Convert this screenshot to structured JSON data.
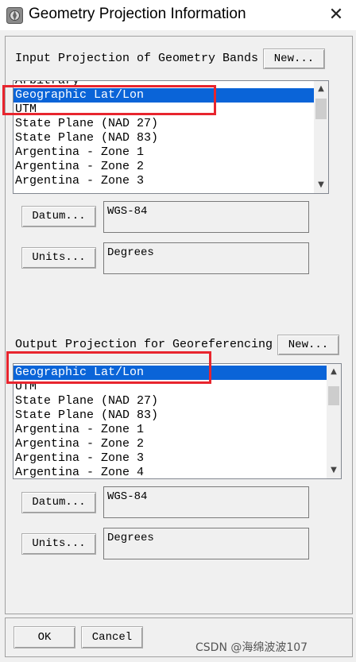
{
  "window": {
    "title": "Geometry Projection Information",
    "close_symbol": "✕"
  },
  "input_section": {
    "label": "Input Projection of Geometry Bands",
    "new_button": "New...",
    "projections": [
      "Arbitrary",
      "Geographic Lat/Lon",
      "UTM",
      "State Plane (NAD 27)",
      "State Plane (NAD 83)",
      "Argentina - Zone 1",
      "Argentina - Zone 2",
      "Argentina - Zone 3"
    ],
    "selected_projection": "Geographic Lat/Lon",
    "datum_button": "Datum...",
    "datum_value": "WGS-84",
    "units_button": "Units...",
    "units_value": "Degrees"
  },
  "output_section": {
    "label": "Output Projection for Georeferencing",
    "new_button": "New...",
    "projections": [
      "Geographic Lat/Lon",
      "UTM",
      "State Plane (NAD 27)",
      "State Plane (NAD 83)",
      "Argentina - Zone 1",
      "Argentina - Zone 2",
      "Argentina - Zone 3",
      "Argentina - Zone 4"
    ],
    "selected_projection": "Geographic Lat/Lon",
    "datum_button": "Datum...",
    "datum_value": "WGS-84",
    "units_button": "Units...",
    "units_value": "Degrees"
  },
  "footer": {
    "ok_button": "OK",
    "cancel_button": "Cancel"
  },
  "watermark": "CSDN @海绵波波107",
  "colors": {
    "selection": "#0a64d8",
    "highlight_box": "#e8252e",
    "dialog_background": "#f0f0f0"
  }
}
